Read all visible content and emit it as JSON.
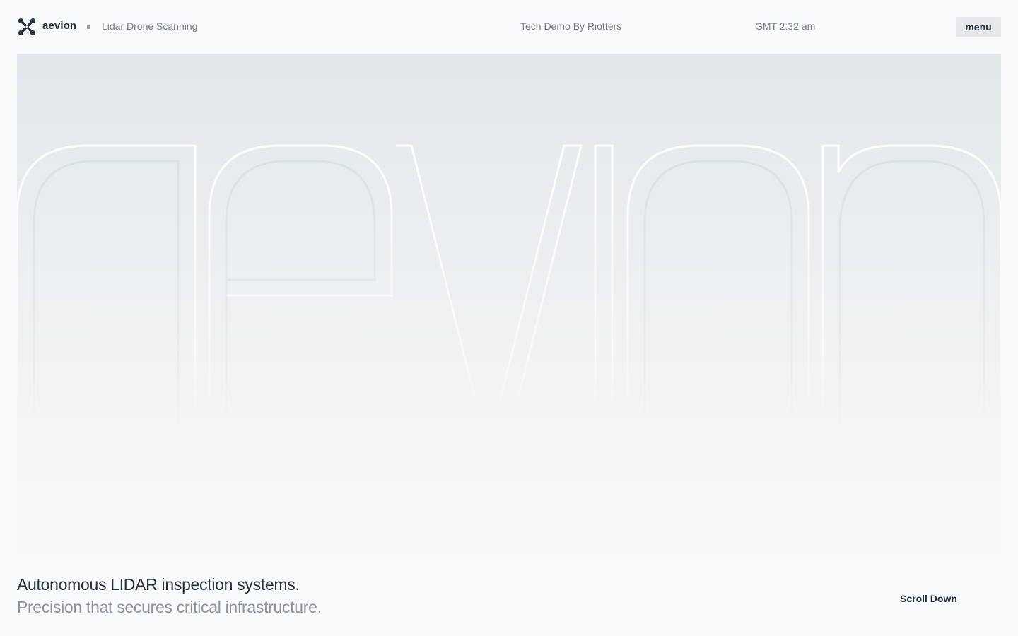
{
  "header": {
    "brand_name": "aevion",
    "logo_icon": "aevion-x-logo-icon",
    "tagline": "Lidar Drone Scanning",
    "credit": "Tech Demo By Riotters",
    "clock": "GMT 2:32 am",
    "menu_label": "menu"
  },
  "hero": {
    "wordmark": "aevion"
  },
  "intro": {
    "headline": "Autonomous LIDAR inspection systems.",
    "subheadline": "Precision that secures critical infrastructure.",
    "scroll_label": "Scroll Down"
  },
  "colors": {
    "background": "#f8f9fa",
    "text_primary": "#25313b",
    "text_secondary": "#737d86",
    "menu_button_bg": "#e6e9eb",
    "hero_top": "#e1e7ea"
  }
}
